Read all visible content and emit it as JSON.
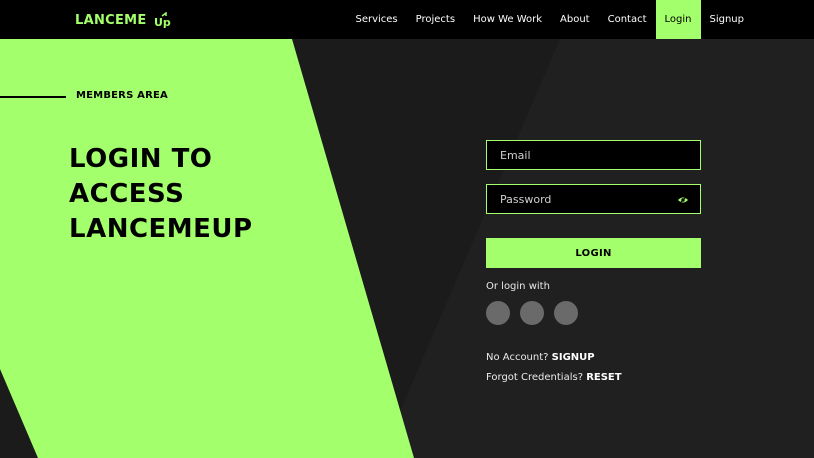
{
  "brand": {
    "name": "LANCEME",
    "mark": "UP"
  },
  "nav": {
    "items": [
      {
        "label": "Services"
      },
      {
        "label": "Projects"
      },
      {
        "label": "How We Work"
      },
      {
        "label": "About"
      },
      {
        "label": "Contact"
      },
      {
        "label": "Login",
        "active": true
      },
      {
        "label": "Signup"
      }
    ]
  },
  "hero": {
    "eyebrow": "MEMBERS AREA",
    "headline": [
      "LOGIN TO",
      "ACCESS",
      "LANCEMEUP"
    ]
  },
  "form": {
    "email_placeholder": "Email",
    "password_placeholder": "Password",
    "login_label": "LOGIN",
    "or_login_with": "Or login with",
    "no_account_text": "No Account?",
    "signup_link": "SIGNUP",
    "forgot_text": "Forgot Credentials?",
    "reset_link": "RESET"
  },
  "icons": {
    "password_toggle": "eye-icon",
    "social": [
      "social-login-icon",
      "social-login-icon",
      "social-login-icon"
    ]
  },
  "colors": {
    "accent": "#a3ff6b",
    "background": "#1a1a1a",
    "header": "#000000"
  }
}
